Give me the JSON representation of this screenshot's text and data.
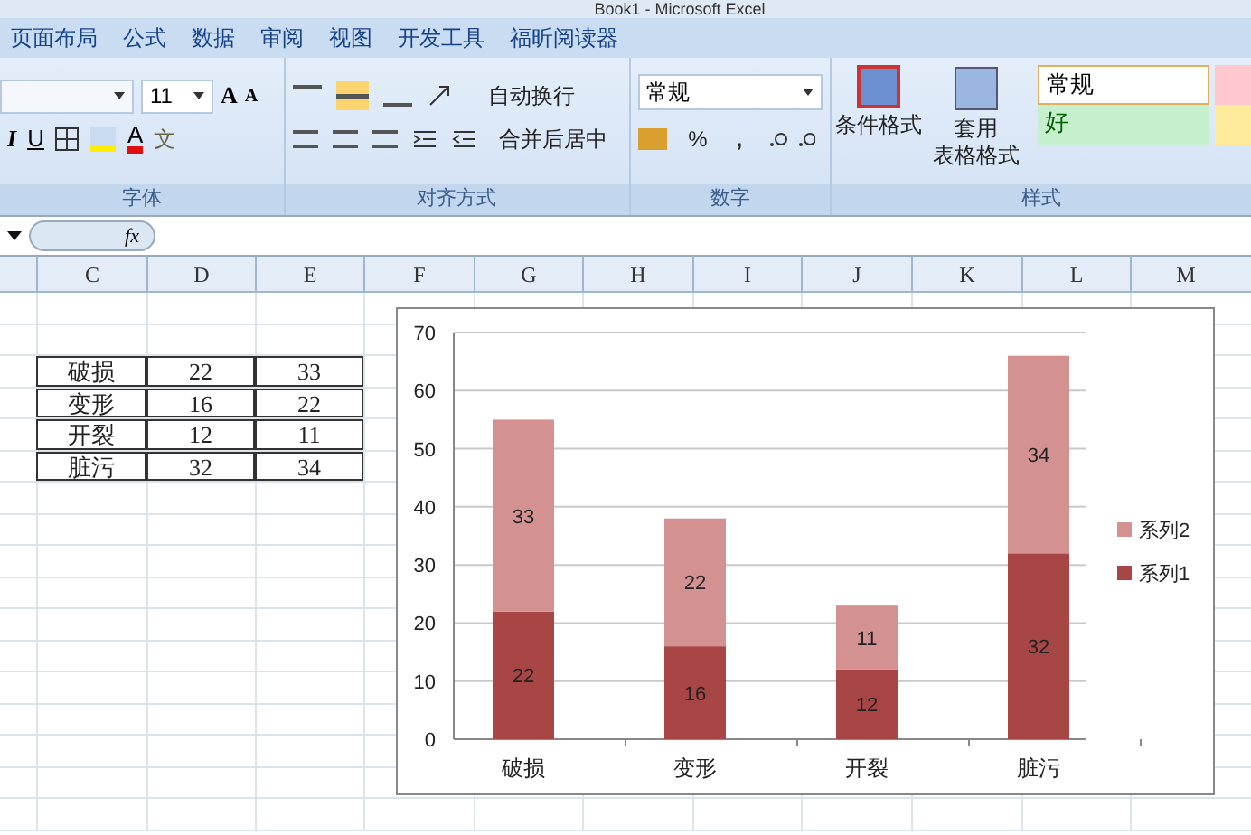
{
  "window": {
    "title": "Book1 - Microsoft Excel"
  },
  "menu_tabs": [
    "页面布局",
    "公式",
    "数据",
    "审阅",
    "视图",
    "开发工具",
    "福昕阅读器"
  ],
  "ribbon": {
    "font": {
      "size": "11",
      "grow": "A",
      "shrink": "A",
      "italic": "I",
      "underline": "U",
      "font_color": "A",
      "phonetic": "文",
      "label": "字体"
    },
    "alignment": {
      "wrap": "自动换行",
      "merge": "合并后居中",
      "label": "对齐方式"
    },
    "number": {
      "format": "常规",
      "percent": "%",
      "comma": ",",
      "label": "数字"
    },
    "styles": {
      "conditional": "条件格式",
      "table_format_1": "套用",
      "table_format_2": "表格格式",
      "normal": "常规",
      "good": "好",
      "label": "样式"
    }
  },
  "formula_bar": {
    "fx": "fx"
  },
  "sheet": {
    "columns": [
      "C",
      "D",
      "E",
      "F",
      "G",
      "H",
      "I",
      "J",
      "K",
      "L",
      "M"
    ],
    "rows": [
      [
        "破损",
        "22",
        "33"
      ],
      [
        "变形",
        "16",
        "22"
      ],
      [
        "开裂",
        "12",
        "11"
      ],
      [
        "脏污",
        "32",
        "34"
      ]
    ]
  },
  "chart": {
    "chart_data": {
      "type": "bar",
      "stacked": true,
      "orientation": "vertical",
      "categories": [
        "破损",
        "变形",
        "开裂",
        "脏污"
      ],
      "series": [
        {
          "name": "系列1",
          "color": "#a84646",
          "values": [
            22,
            16,
            12,
            32
          ],
          "value_labels": [
            "22",
            "16",
            "12",
            "32"
          ]
        },
        {
          "name": "系列2",
          "color": "#d39191",
          "values": [
            33,
            22,
            11,
            34
          ],
          "value_labels": [
            "33",
            "22",
            "11",
            "34"
          ]
        }
      ],
      "ylim": [
        0,
        70
      ],
      "yticks": [
        0,
        10,
        20,
        30,
        40,
        50,
        60,
        70
      ],
      "data_labels": true,
      "grid": true,
      "legend": "right"
    }
  }
}
